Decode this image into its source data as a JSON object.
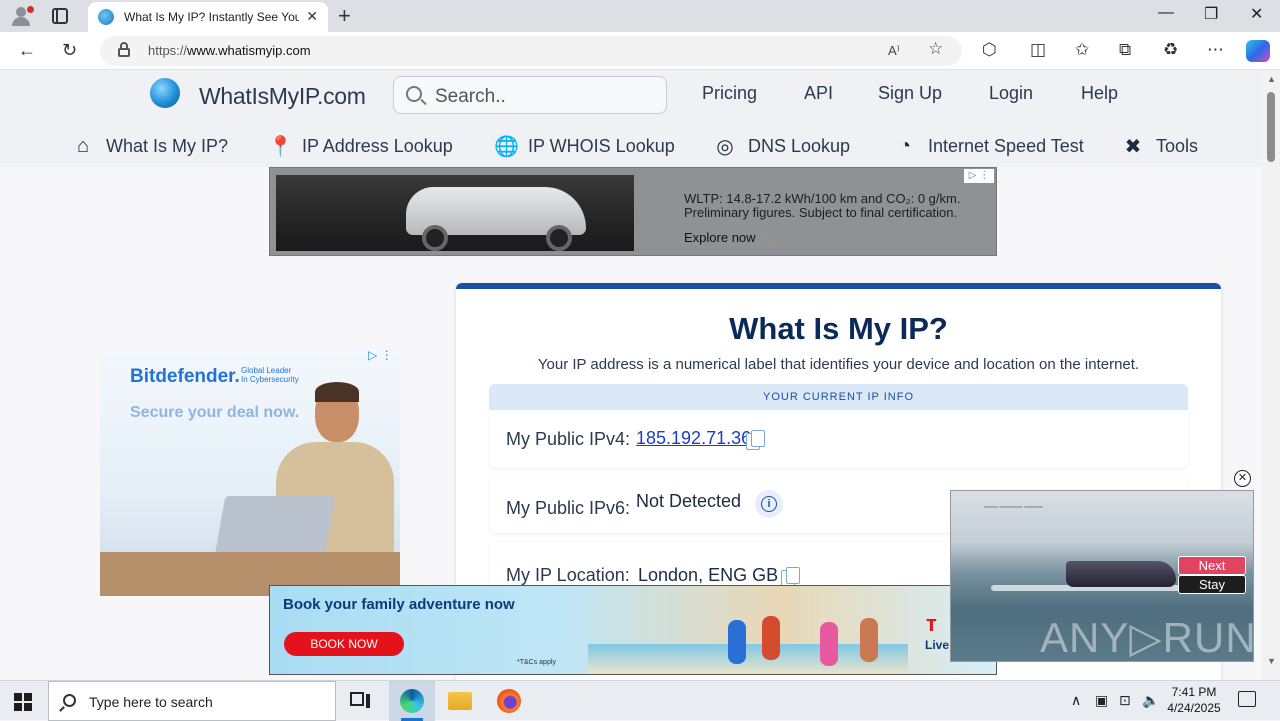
{
  "browser": {
    "tab_title": "What Is My IP? Instantly See Your",
    "tab_close": "✕",
    "new_tab": "+",
    "window_min": "—",
    "window_max": "❐",
    "window_close": "✕",
    "url_prefix": "https://",
    "url_host": "www.whatismyip.com",
    "read_aloud": "A⁾",
    "favorite": "☆",
    "icons": [
      "back-icon",
      "refresh-icon",
      "lock-icon",
      "extensions-icon",
      "split-screen-icon",
      "favorites-icon",
      "collections-icon",
      "performance-icon",
      "more-icon",
      "copilot-icon"
    ]
  },
  "site": {
    "logo": "WhatIsMyIP.com",
    "search_placeholder": "Search..",
    "top_nav": [
      "Pricing",
      "API",
      "Sign Up",
      "Login",
      "Help"
    ],
    "sub_nav": [
      {
        "label": "What Is My IP?",
        "icon": "home-icon"
      },
      {
        "label": "IP Address Lookup",
        "icon": "map-pin-icon"
      },
      {
        "label": "IP WHOIS Lookup",
        "icon": "globe-icon"
      },
      {
        "label": "DNS Lookup",
        "icon": "dns-icon"
      },
      {
        "label": "Internet Speed Test",
        "icon": "speedometer-icon"
      },
      {
        "label": "Tools",
        "icon": "tools-icon"
      }
    ]
  },
  "ads": {
    "top": {
      "line1": "WLTP: 14.8-17.2 kWh/100 km and CO₂: 0 g/km.",
      "line2": "Preliminary figures. Subject to final certification.",
      "cta": "Explore now",
      "cta_arrow": "→"
    },
    "left": {
      "brand": "Bitdefender.",
      "tagline_1": "Global Leader",
      "tagline_2": "In Cybersecurity",
      "headline": "Secure your deal now."
    },
    "bottom": {
      "headline": "Book your family adventure now",
      "button": "BOOK NOW",
      "terms": "*T&Cs apply",
      "brand_suffix": "Live"
    }
  },
  "main": {
    "title": "What Is My IP?",
    "description": "Your IP address is a numerical label that identifies your device and location on the internet.",
    "info_header": "YOUR CURRENT IP INFO",
    "rows": [
      {
        "label": "My Public IPv4:",
        "value": "185.192.71.36"
      },
      {
        "label": "My Public IPv6:",
        "value": "Not Detected"
      },
      {
        "label": "My IP Location:",
        "value": "London, ENG GB"
      }
    ]
  },
  "video": {
    "next": "Next",
    "stay": "Stay",
    "close": "✕",
    "watermark": "ANY▷RUN"
  },
  "taskbar": {
    "search_placeholder": "Type here to search",
    "time": "7:41 PM",
    "date": "4/24/2025"
  }
}
